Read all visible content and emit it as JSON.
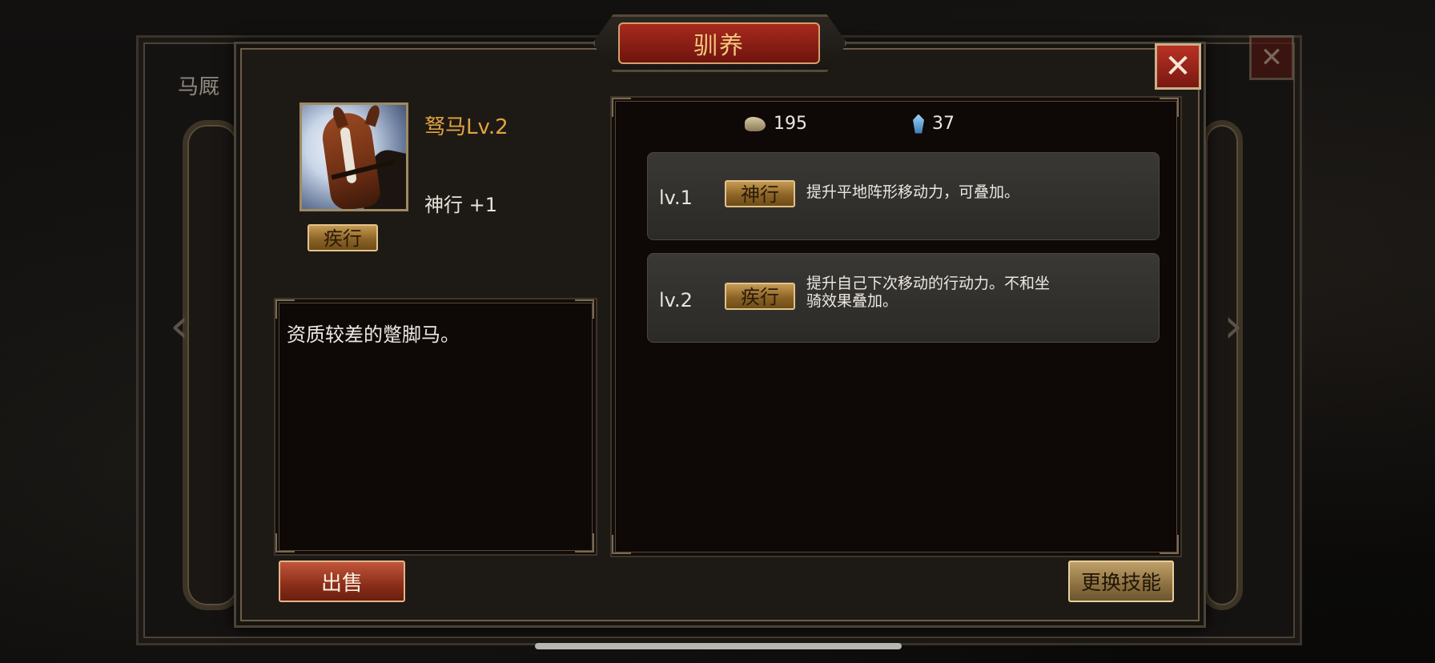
{
  "background_window": {
    "tab_label": "马厩",
    "close_icon": "close-icon"
  },
  "dialog": {
    "title": "驯养",
    "close_icon": "close-icon"
  },
  "horse": {
    "portrait_icon": "horse-portrait",
    "name": "驽马Lv.2",
    "stat": "神行 +1",
    "skill_badge": "疾行",
    "description": "资质较差的蹩脚马。"
  },
  "resources": [
    {
      "icon": "hay-icon",
      "value": "195"
    },
    {
      "icon": "gem-icon",
      "value": "37"
    }
  ],
  "skills": [
    {
      "level": "lv.1",
      "name": "神行",
      "desc_lines": [
        "提升平地阵形移动力，可叠加。"
      ]
    },
    {
      "level": "lv.2",
      "name": "疾行",
      "desc_lines": [
        "提升自己下次移动的行动力。不和坐",
        "骑效果叠加。"
      ]
    }
  ],
  "buttons": {
    "sell": "出售",
    "change_skill": "更换技能"
  },
  "colors": {
    "title_red": "#a82a1e",
    "name_gold": "#e3a43e",
    "badge_gold": "#c69a52"
  }
}
